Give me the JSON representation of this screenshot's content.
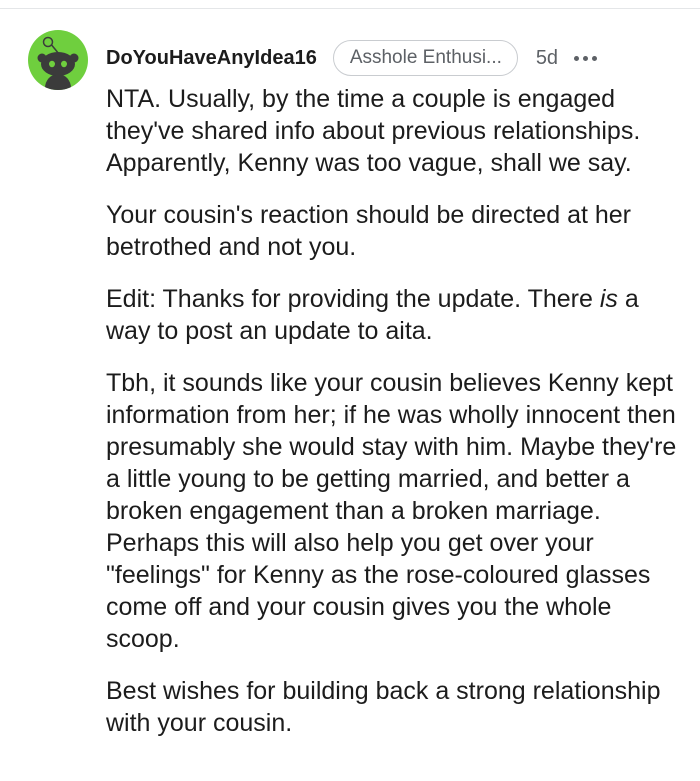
{
  "comment": {
    "username": "DoYouHaveAnyIdea16",
    "flair": "Asshole Enthusi...",
    "age": "5d",
    "paragraphs": [
      "NTA. Usually, by the time a couple is engaged they've shared info about previous relationships. Apparently, Kenny was too vague, shall we say.",
      "Your cousin's reaction should be directed at her betrothed and not you.",
      {
        "before": "Edit: Thanks for providing the update. There ",
        "emphasis": "is",
        "after": " a way to post an update to aita."
      },
      "Tbh, it sounds like your cousin believes Kenny kept information from her; if he was wholly innocent then presumably she would stay with him. Maybe they're a little young to be getting married, and better a broken engagement than a broken marriage. Perhaps this will also help you get over your \"feelings\" for Kenny as the rose-coloured glasses come off and your cousin gives you the whole scoop.",
      "Best wishes for building back a strong relationship with your cousin."
    ]
  },
  "icons": {
    "avatar": "reddit-snoo-avatar-icon",
    "more": "more-options-icon"
  },
  "colors": {
    "avatar_bg": "#6fcf3e",
    "text": "#1c1c1c",
    "meta": "#5d6166"
  }
}
